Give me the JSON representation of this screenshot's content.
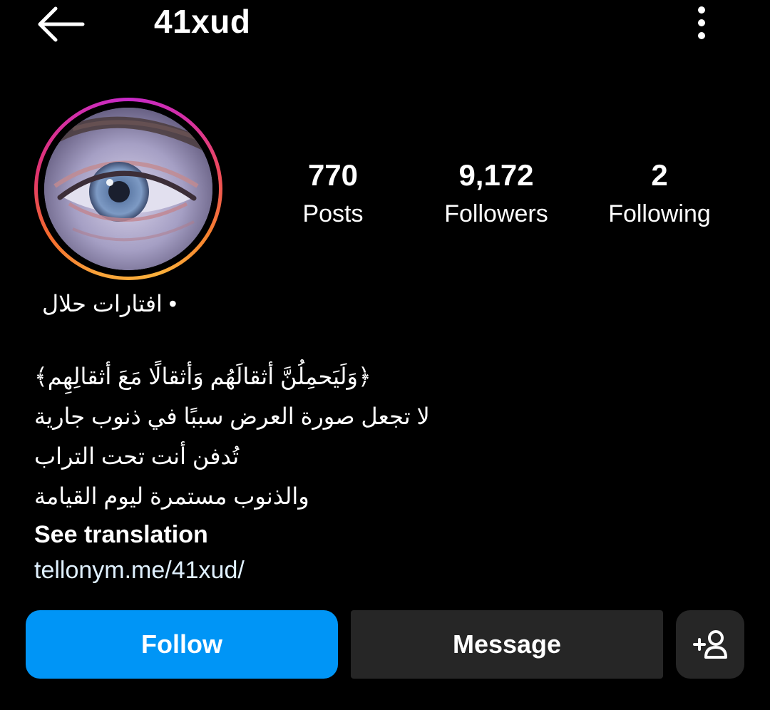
{
  "header": {
    "username": "41xud",
    "back_icon": "arrow-left-icon",
    "more_icon": "more-vertical-icon"
  },
  "profile": {
    "avatar_description_icon": "profile-avatar",
    "ring_colors": [
      "#f9a33a",
      "#e0336f",
      "#c82ac9"
    ]
  },
  "stats": {
    "posts": {
      "value": "770",
      "label": "Posts"
    },
    "followers": {
      "value": "9,172",
      "label": "Followers"
    },
    "following": {
      "value": "2",
      "label": "Following"
    }
  },
  "bio": {
    "category": "• افتارات حلال",
    "lines": [
      "﴿وَلَيَحمِلُنَّ أثقالَهُم وَأثقالًا مَعَ أثقالِهِم﴾",
      "لا تجعل صورة العرض سببًا في ذنوب جارية",
      "تُدفن أنت تحت التراب",
      "والذنوب مستمرة ليوم القيامة"
    ],
    "see_translation": "See translation",
    "link": "tellonym.me/41xud/"
  },
  "actions": {
    "follow_label": "Follow",
    "message_label": "Message",
    "suggest_icon": "add-person-icon",
    "follow_color": "#0095f6",
    "secondary_color": "#262626"
  }
}
